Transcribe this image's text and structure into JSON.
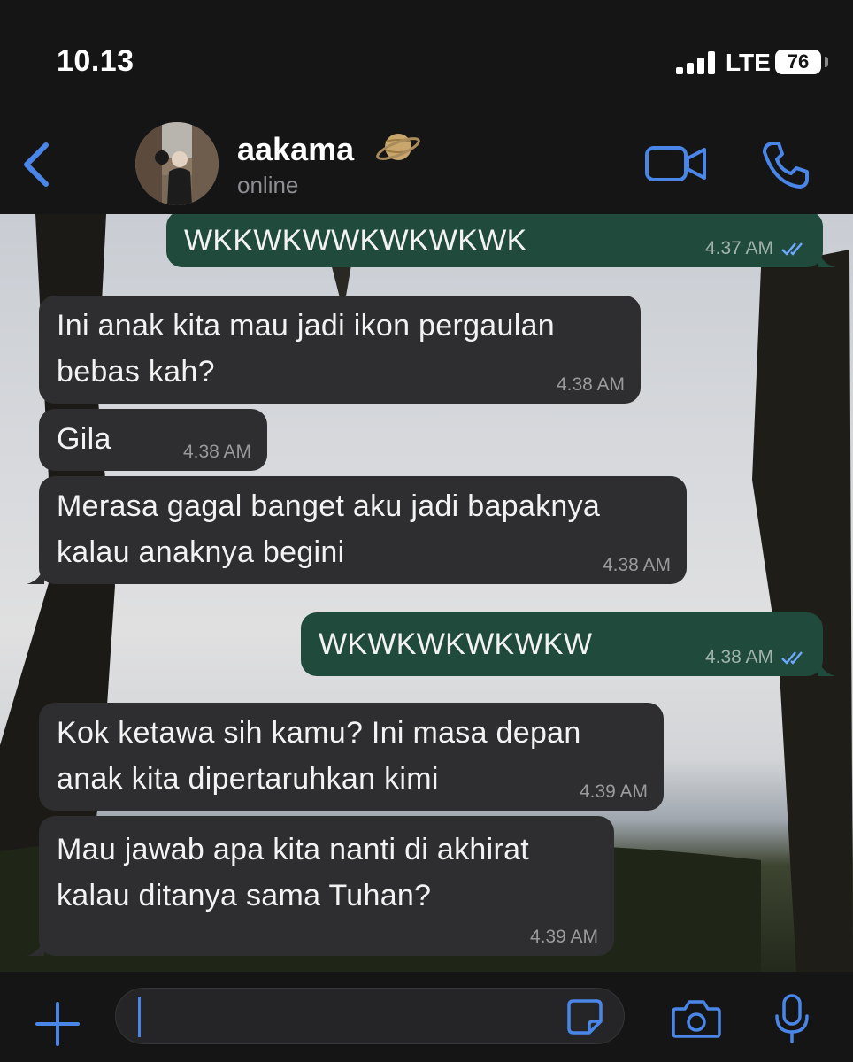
{
  "status_bar": {
    "time": "10.13",
    "network": "LTE",
    "battery": "76"
  },
  "header": {
    "contact_name": "aakama",
    "contact_status": "online"
  },
  "colors": {
    "accent": "#4a86e8",
    "outgoing_bubble": "#1f4a3c",
    "incoming_bubble": "#2e2e30",
    "bar_background": "#151515"
  },
  "messages": [
    {
      "direction": "out",
      "text": "WKKWKWWKWKWKWK",
      "time": "4.37 AM",
      "read": true
    },
    {
      "direction": "in",
      "lines": [
        "Ini anak kita mau jadi ikon pergaulan",
        "bebas kah?"
      ],
      "time": "4.38 AM"
    },
    {
      "direction": "in",
      "text": "Gila",
      "time": "4.38 AM"
    },
    {
      "direction": "in",
      "lines": [
        "Merasa gagal banget aku jadi bapaknya",
        "kalau anaknya begini"
      ],
      "time": "4.38 AM"
    },
    {
      "direction": "out",
      "text": "WKWKWKWKWKW",
      "time": "4.38 AM",
      "read": true
    },
    {
      "direction": "in",
      "lines": [
        "Kok ketawa sih kamu? Ini masa depan",
        "anak kita dipertaruhkan kimi"
      ],
      "time": "4.39 AM"
    },
    {
      "direction": "in",
      "lines": [
        "Mau jawab apa kita nanti di akhirat",
        "kalau ditanya sama Tuhan?"
      ],
      "time": "4.39 AM"
    }
  ],
  "icons": [
    "back-chevron-icon",
    "planet-emoji-icon",
    "video-call-icon",
    "phone-call-icon",
    "plus-icon",
    "sticker-icon",
    "camera-icon",
    "microphone-icon",
    "double-check-icon"
  ]
}
